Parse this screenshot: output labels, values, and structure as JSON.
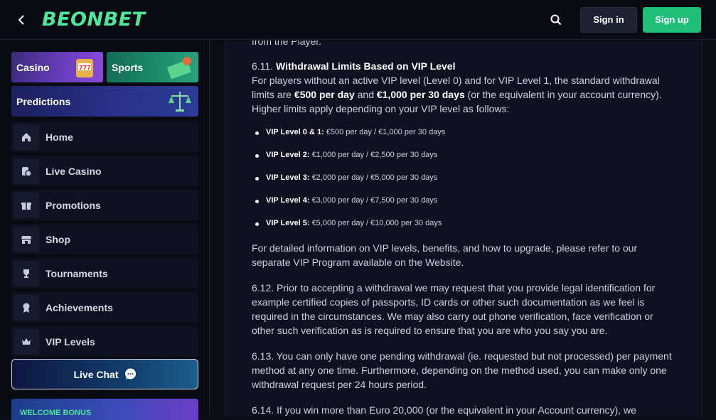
{
  "header": {
    "logo": "BEONBET",
    "sign_in": "Sign in",
    "sign_up": "Sign up"
  },
  "sidebar": {
    "banners": {
      "casino": "Casino",
      "sports": "Sports",
      "predictions": "Predictions"
    },
    "items": [
      {
        "label": "Home",
        "icon": "home-icon"
      },
      {
        "label": "Live Casino",
        "icon": "live-casino-icon"
      },
      {
        "label": "Promotions",
        "icon": "gift-icon"
      },
      {
        "label": "Shop",
        "icon": "shop-icon"
      },
      {
        "label": "Tournaments",
        "icon": "trophy-icon"
      },
      {
        "label": "Achievements",
        "icon": "medal-icon"
      },
      {
        "label": "VIP Levels",
        "icon": "crown-icon"
      }
    ],
    "live_chat": "Live Chat",
    "welcome": "WELCOME BONUS"
  },
  "content": {
    "top_fragment": "from the Player.",
    "s611_num": "6.11.",
    "s611_title": "Withdrawal Limits Based on VIP Level",
    "s611_p1a": "For players without an active VIP level (Level 0) and for VIP Level 1, the standard withdrawal limits are ",
    "s611_p1b": "€500 per day",
    "s611_p1c": " and ",
    "s611_p1d": "€1,000 per 30 days",
    "s611_p1e": " (or the equivalent in your account currency). Higher limits apply depending on your VIP level as follows:",
    "vip_levels": [
      {
        "level": "VIP Level 0 & 1:",
        "limits": "€500 per day / €1,000 per 30 days"
      },
      {
        "level": "VIP Level 2:",
        "limits": "€1,000 per day / €2,500 per 30 days"
      },
      {
        "level": "VIP Level 3:",
        "limits": "€2,000 per day / €5,000 per 30 days"
      },
      {
        "level": "VIP Level 4:",
        "limits": "€3,000 per day / €7,500 per 30 days"
      },
      {
        "level": "VIP Level 5:",
        "limits": "€5,000 per day / €10,000 per 30 days"
      }
    ],
    "vip_info": "For detailed information on VIP levels, benefits, and how to upgrade, please refer to our separate VIP Program available on the Website.",
    "s612": "6.12. Prior to accepting a withdrawal we may request that you provide legal identification for example certified copies of passports, ID cards or other such documentation as we feel is required in the circumstances. We may also carry out phone verification, face verification or other such verification as is required to ensure that you are who you say you are.",
    "s613": "6.13. You can only have one pending withdrawal (ie. requested but not processed) per payment method at any one time. Furthermore, depending on the method used, you can make only one withdrawal request per 24 hours period.",
    "s614": "6.14. If you win more than Euro 20,000 (or the equivalent in your Account currency), we"
  },
  "colors": {
    "accent_green": "#1fbf7a",
    "logo_green": "#4ee59a",
    "panel_bg": "#0f1120",
    "page_bg": "#0b0c14"
  }
}
